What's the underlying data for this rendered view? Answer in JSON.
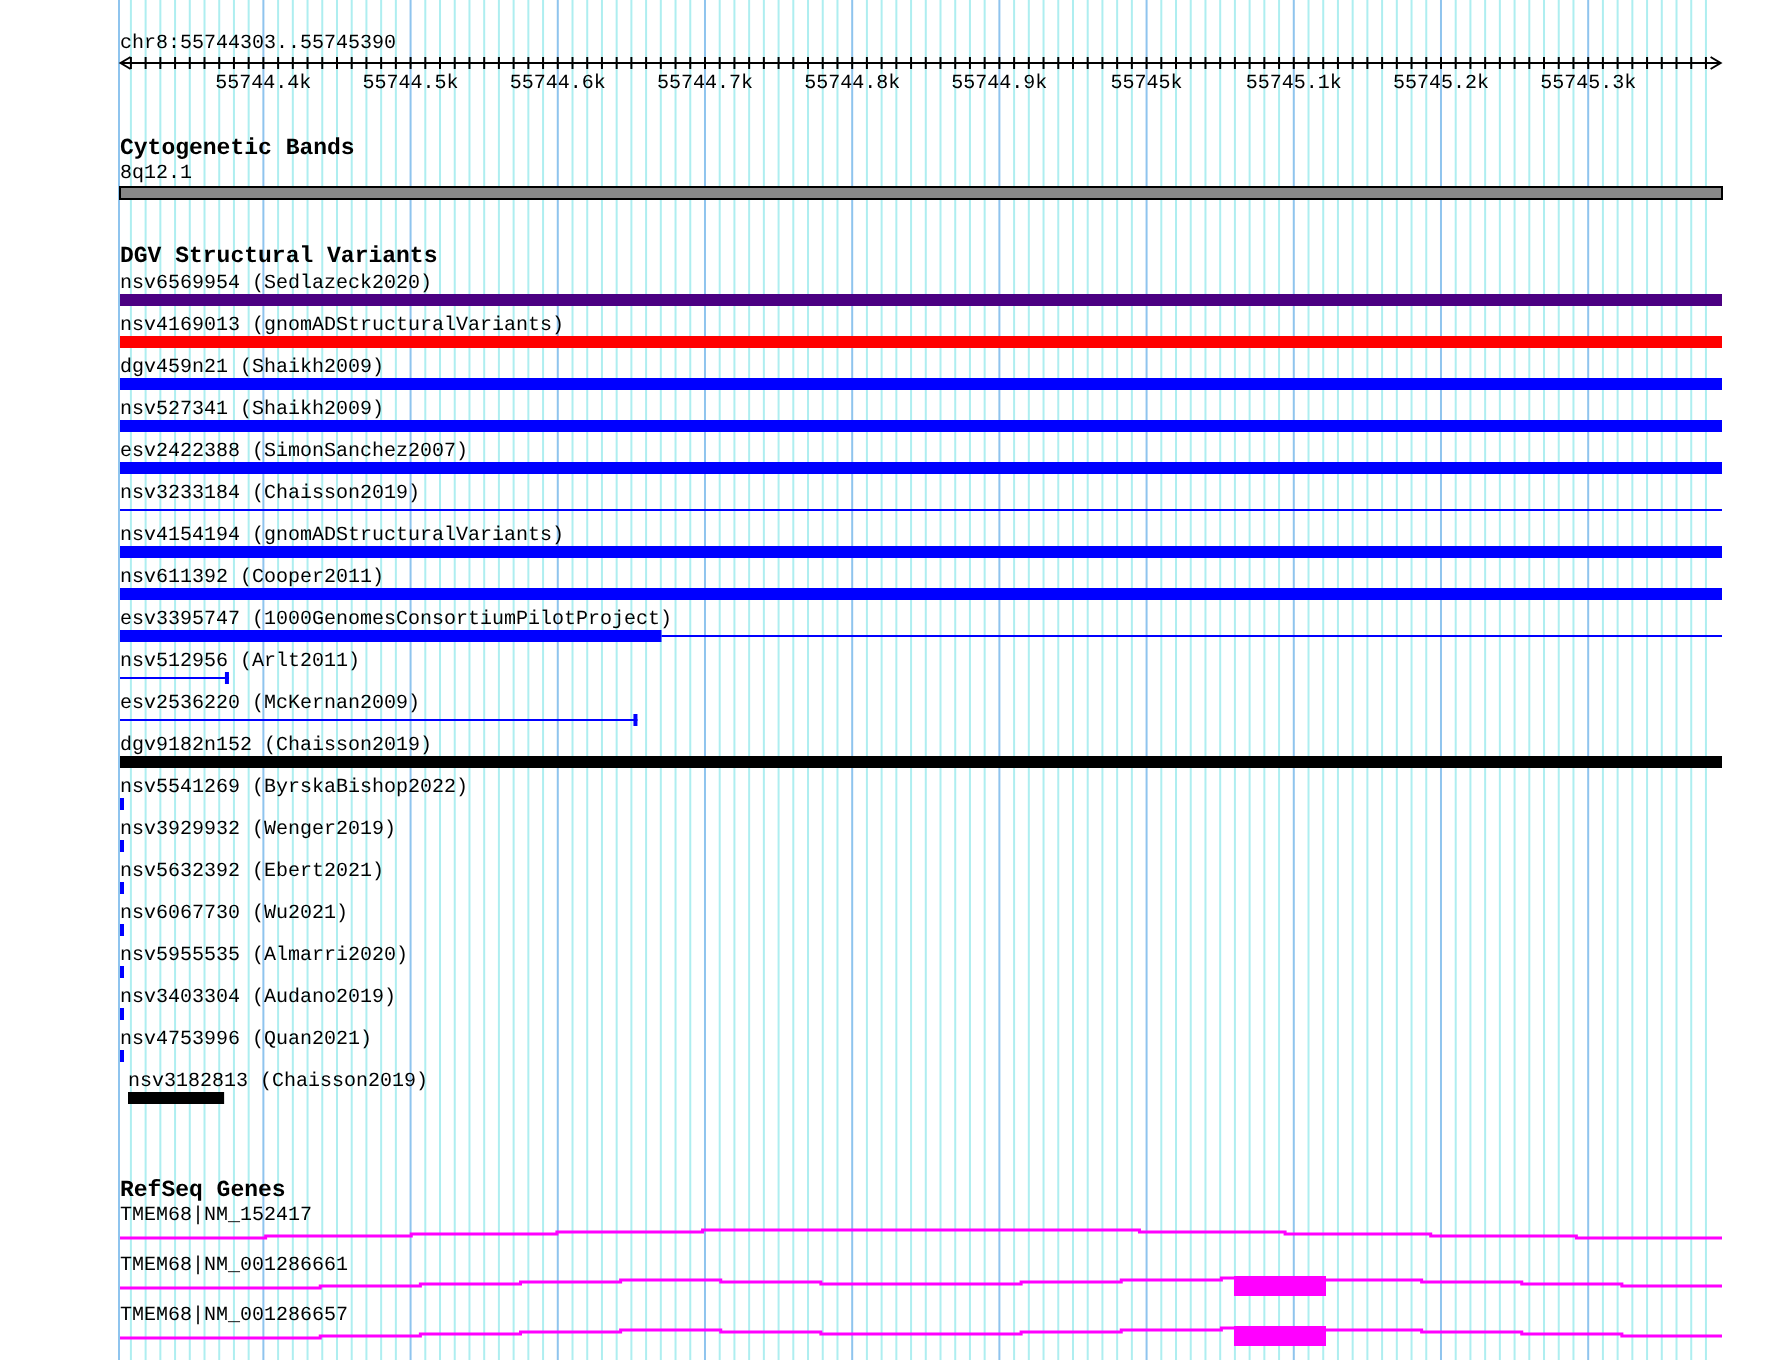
{
  "ruler": {
    "position": "chr8:55744303..55745390",
    "ticks": [
      "55744.4k",
      "55744.5k",
      "55744.6k",
      "55744.7k",
      "55744.8k",
      "55744.9k",
      "55745k",
      "55745.1k",
      "55745.2k",
      "55745.3k"
    ]
  },
  "cytoband": {
    "title": "Cytogenetic Bands",
    "band": "8q12.1"
  },
  "dgv": {
    "title": "DGV Structural Variants",
    "variants": [
      {
        "label": "nsv6569954 (Sedlazeck2020)",
        "color": "#4b0082",
        "kind": "bar",
        "level": 1
      },
      {
        "label": "nsv4169013 (gnomADStructuralVariants)",
        "color": "#ff0000",
        "kind": "bar",
        "level": 1
      },
      {
        "label": "dgv459n21 (Shaikh2009)",
        "color": "#0000ff",
        "kind": "bar",
        "level": 1
      },
      {
        "label": "nsv527341 (Shaikh2009)",
        "color": "#0000ff",
        "kind": "bar",
        "level": 1
      },
      {
        "label": "esv2422388 (SimonSanchez2007)",
        "color": "#0000ff",
        "kind": "bar",
        "level": 1
      },
      {
        "label": "nsv3233184 (Chaisson2019)",
        "color": "#0000ff",
        "kind": "line",
        "level": 1
      },
      {
        "label": "nsv4154194 (gnomADStructuralVariants)",
        "color": "#0000ff",
        "kind": "bar",
        "level": 1
      },
      {
        "label": "nsv611392 (Cooper2011)",
        "color": "#0000ff",
        "kind": "bar",
        "level": 1
      },
      {
        "label": "esv3395747 (1000GenomesConsortiumPilotProject)",
        "color": "#0000ff",
        "kind": "barline",
        "level": 0.338
      },
      {
        "label": "nsv512956 (Arlt2011)",
        "color": "#0000ff",
        "kind": "line",
        "level": 0.068
      },
      {
        "label": "esv2536220 (McKernan2009)",
        "color": "#0000ff",
        "kind": "line",
        "level": 0.323
      },
      {
        "label": "dgv9182n152 (Chaisson2019)",
        "color": "#000000",
        "kind": "bar",
        "level": 1
      },
      {
        "label": "nsv5541269 (ByrskaBishop2022)",
        "color": "#0000ff",
        "kind": "mark",
        "level": 0.0025
      },
      {
        "label": "nsv3929932 (Wenger2019)",
        "color": "#0000ff",
        "kind": "mark",
        "level": 0.0025
      },
      {
        "label": "nsv5632392 (Ebert2021)",
        "color": "#0000ff",
        "kind": "mark",
        "level": 0.0025
      },
      {
        "label": "nsv6067730 (Wu2021)",
        "color": "#0000ff",
        "kind": "mark",
        "level": 0.0025
      },
      {
        "label": "nsv5955535 (Almarri2020)",
        "color": "#0000ff",
        "kind": "mark",
        "level": 0.0025
      },
      {
        "label": "nsv3403304 (Audano2019)",
        "color": "#0000ff",
        "kind": "mark",
        "level": 0.0025
      },
      {
        "label": "nsv4753996 (Quan2021)",
        "color": "#0000ff",
        "kind": "mark",
        "level": 0.0025
      },
      {
        "label": "nsv3182813 (Chaisson2019)",
        "color": "#000000",
        "kind": "inset",
        "level": 0.06
      }
    ]
  },
  "refseq": {
    "title": "RefSeq Genes",
    "genes": [
      {
        "label": "TMEM68|NM_152417",
        "coding_block": false
      },
      {
        "label": "TMEM68|NM_001286661",
        "coding_block": true
      },
      {
        "label": "TMEM68|NM_001286657",
        "coding_block": true
      }
    ]
  }
}
